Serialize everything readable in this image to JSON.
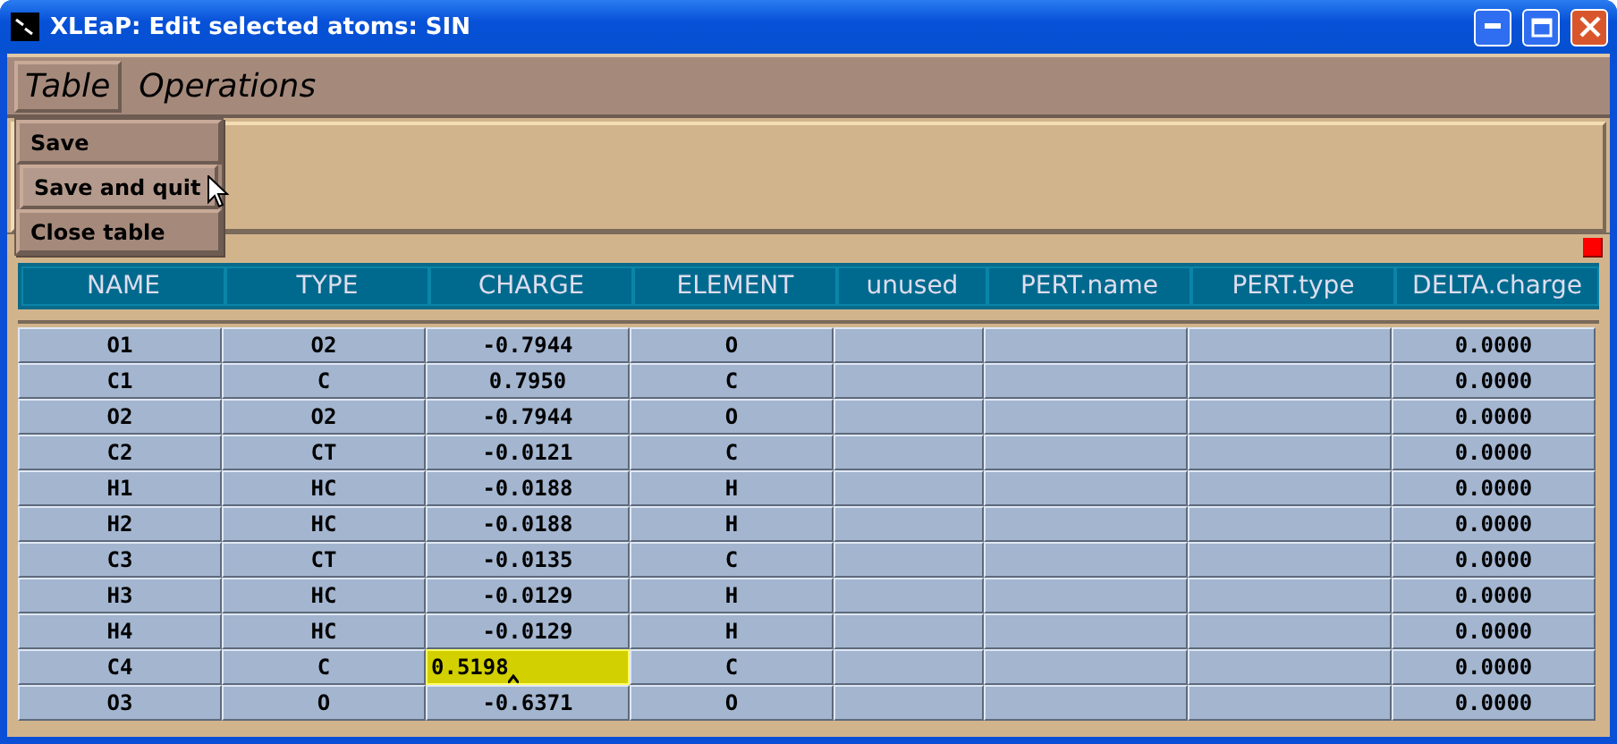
{
  "window": {
    "title": "XLEaP: Edit selected atoms: SIN"
  },
  "menubar": [
    {
      "label": "Table",
      "selected": true
    },
    {
      "label": "Operations",
      "selected": false
    }
  ],
  "menu": [
    {
      "label": "Save",
      "selected": false
    },
    {
      "label": "Save and quit",
      "selected": true
    },
    {
      "label": "Close table",
      "selected": false
    }
  ],
  "table": {
    "columns": [
      "NAME",
      "TYPE",
      "CHARGE",
      "ELEMENT",
      "unused",
      "PERT.name",
      "PERT.type",
      "DELTA.charge"
    ],
    "rows": [
      {
        "name": "O1",
        "type": "O2",
        "charge": "-0.7944",
        "element": "O",
        "delta_charge": "0.0000",
        "editing": false
      },
      {
        "name": "C1",
        "type": "C",
        "charge": "0.7950",
        "element": "C",
        "delta_charge": "0.0000",
        "editing": false
      },
      {
        "name": "O2",
        "type": "O2",
        "charge": "-0.7944",
        "element": "O",
        "delta_charge": "0.0000",
        "editing": false
      },
      {
        "name": "C2",
        "type": "CT",
        "charge": "-0.0121",
        "element": "C",
        "delta_charge": "0.0000",
        "editing": false
      },
      {
        "name": "H1",
        "type": "HC",
        "charge": "-0.0188",
        "element": "H",
        "delta_charge": "0.0000",
        "editing": false
      },
      {
        "name": "H2",
        "type": "HC",
        "charge": "-0.0188",
        "element": "H",
        "delta_charge": "0.0000",
        "editing": false
      },
      {
        "name": "C3",
        "type": "CT",
        "charge": "-0.0135",
        "element": "C",
        "delta_charge": "0.0000",
        "editing": false
      },
      {
        "name": "H3",
        "type": "HC",
        "charge": "-0.0129",
        "element": "H",
        "delta_charge": "0.0000",
        "editing": false
      },
      {
        "name": "H4",
        "type": "HC",
        "charge": "-0.0129",
        "element": "H",
        "delta_charge": "0.0000",
        "editing": false
      },
      {
        "name": "C4",
        "type": "C",
        "charge": "0.5198",
        "element": "C",
        "delta_charge": "0.0000",
        "editing": true
      },
      {
        "name": "O3",
        "type": "O",
        "charge": "-0.6371",
        "element": "O",
        "delta_charge": "0.0000",
        "editing": false
      }
    ]
  }
}
